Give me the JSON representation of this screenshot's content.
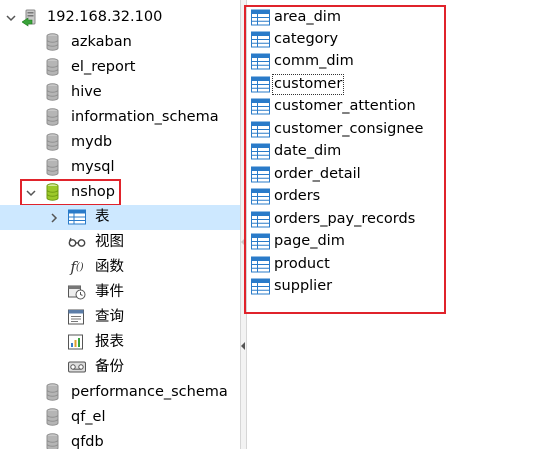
{
  "connection": {
    "label": "192.168.32.100"
  },
  "databases_top": [
    {
      "label": "azkaban"
    },
    {
      "label": "el_report"
    },
    {
      "label": "hive"
    },
    {
      "label": "information_schema"
    },
    {
      "label": "mydb"
    },
    {
      "label": "mysql"
    }
  ],
  "selected_db": {
    "label": "nshop"
  },
  "sub_nodes": [
    {
      "label": "表",
      "icon": "table-grid-icon"
    },
    {
      "label": "视图",
      "icon": "view-glasses-icon"
    },
    {
      "label": "函数",
      "icon": "function-icon"
    },
    {
      "label": "事件",
      "icon": "event-clock-icon"
    },
    {
      "label": "查询",
      "icon": "query-icon"
    },
    {
      "label": "报表",
      "icon": "report-icon"
    },
    {
      "label": "备份",
      "icon": "backup-icon"
    }
  ],
  "databases_bottom": [
    {
      "label": "performance_schema"
    },
    {
      "label": "qf_el"
    },
    {
      "label": "qfdb"
    }
  ],
  "tables": [
    {
      "label": "area_dim"
    },
    {
      "label": "category"
    },
    {
      "label": "comm_dim"
    },
    {
      "label": "customer"
    },
    {
      "label": "customer_attention"
    },
    {
      "label": "customer_consignee"
    },
    {
      "label": "date_dim"
    },
    {
      "label": "order_detail"
    },
    {
      "label": "orders"
    },
    {
      "label": "orders_pay_records"
    },
    {
      "label": "page_dim"
    },
    {
      "label": "product"
    },
    {
      "label": "supplier"
    }
  ],
  "colors": {
    "highlight": "#e0232b",
    "selected_row": "#cde8ff",
    "table_icon": "#2a7bc9",
    "db_icon_gray": "#9a9a9a",
    "db_icon_active": "#86b81e"
  }
}
